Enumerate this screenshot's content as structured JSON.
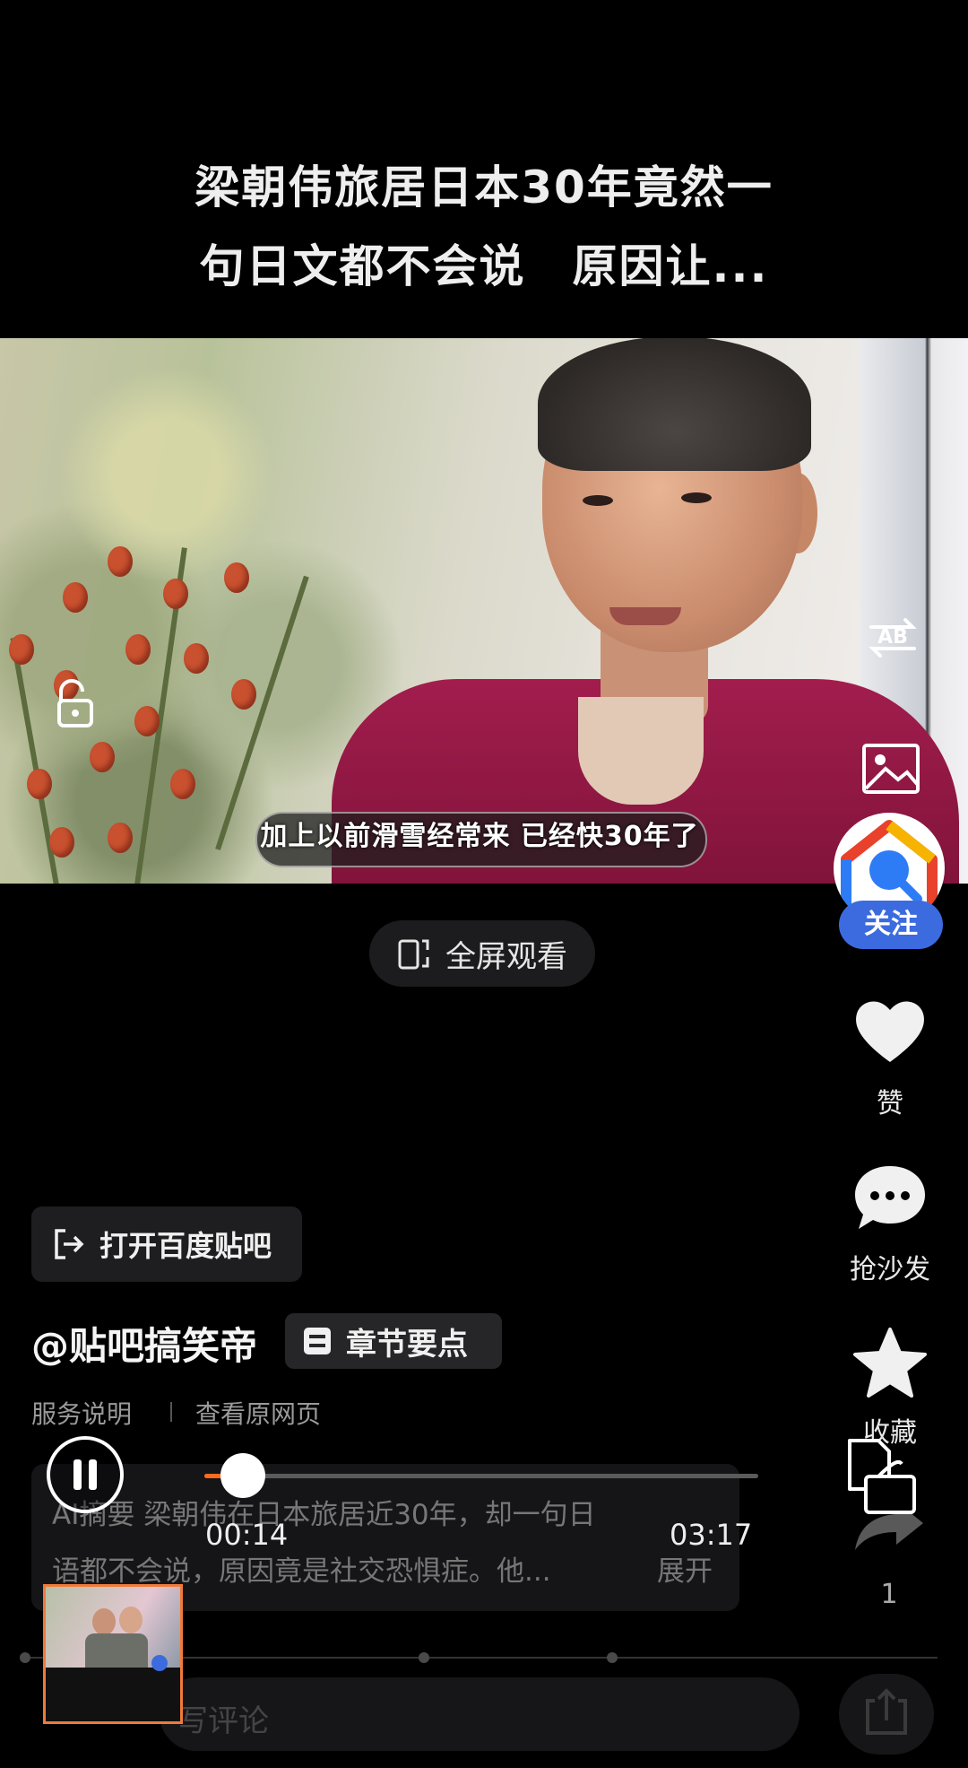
{
  "video": {
    "title_line1": "梁朝伟旅居日本30年竟然一",
    "title_line2": "句日文都不会说　原因让...",
    "subtitle": "加上以前滑雪经常来 已经快30年了"
  },
  "fullscreen": {
    "label": "全屏观看"
  },
  "rail": {
    "follow_label": "关注",
    "like_label": "赞",
    "comment_label": "抢沙发",
    "favorite_label": "收藏",
    "share_count": "1"
  },
  "info": {
    "open_app_label": "打开百度贴吧",
    "author": "@贴吧搞笑帝",
    "chapter_label": "章节要点",
    "service_link": "服务说明",
    "original_link": "查看原网页",
    "summary_line1": "AI摘要 梁朝伟在日本旅居近30年，却一句日",
    "summary_line2": "语都不会说，原因竟是社交恐惧症。他...",
    "expand_label": "展开"
  },
  "player": {
    "current_time": "00:14",
    "total_time": "03:17",
    "progress": 0.07
  },
  "comment": {
    "placeholder": "写评论"
  },
  "colors": {
    "accent": "#3c6be0",
    "progress": "#ff6a1f",
    "preview_border": "#f07a3a"
  }
}
